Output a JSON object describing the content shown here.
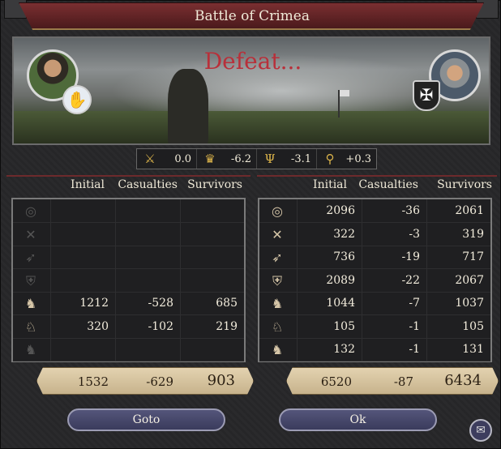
{
  "window": {
    "title": "Battle of Crimea"
  },
  "scene": {
    "outcome": "Defeat..."
  },
  "modifiers": [
    {
      "icon": "crossed-axes-icon",
      "glyph": "⚔",
      "value": "0.0"
    },
    {
      "icon": "crown-icon",
      "glyph": "♛",
      "value": "-6.2"
    },
    {
      "icon": "menorah-icon",
      "glyph": "Ψ",
      "value": "-3.1"
    },
    {
      "icon": "magnifier-icon",
      "glyph": "⚲",
      "value": "+0.3"
    }
  ],
  "headers": {
    "initial": "Initial",
    "casualties": "Casualties",
    "survivors": "Survivors"
  },
  "left_side": {
    "rows": [
      {
        "unit": "light-infantry-icon",
        "glyph": "◎",
        "initial": "",
        "casualties": "",
        "survivors": ""
      },
      {
        "unit": "heavy-infantry-icon",
        "glyph": "✕",
        "initial": "",
        "casualties": "",
        "survivors": ""
      },
      {
        "unit": "archers-icon",
        "glyph": "➶",
        "initial": "",
        "casualties": "",
        "survivors": ""
      },
      {
        "unit": "pikemen-icon",
        "glyph": "⛨",
        "initial": "",
        "casualties": "",
        "survivors": ""
      },
      {
        "unit": "light-cavalry-icon",
        "glyph": "♞",
        "initial": "1212",
        "casualties": "-528",
        "survivors": "685"
      },
      {
        "unit": "knights-icon",
        "glyph": "♘",
        "initial": "320",
        "casualties": "-102",
        "survivors": "219"
      },
      {
        "unit": "horse-archers-icon",
        "glyph": "♞",
        "initial": "",
        "casualties": "",
        "survivors": ""
      }
    ],
    "totals": {
      "initial": "1532",
      "casualties": "-629",
      "survivors": "903"
    }
  },
  "right_side": {
    "rows": [
      {
        "unit": "light-infantry-icon",
        "glyph": "◎",
        "initial": "2096",
        "casualties": "-36",
        "survivors": "2061"
      },
      {
        "unit": "heavy-infantry-icon",
        "glyph": "✕",
        "initial": "322",
        "casualties": "-3",
        "survivors": "319"
      },
      {
        "unit": "archers-icon",
        "glyph": "➶",
        "initial": "736",
        "casualties": "-19",
        "survivors": "717"
      },
      {
        "unit": "pikemen-icon",
        "glyph": "⛨",
        "initial": "2089",
        "casualties": "-22",
        "survivors": "2067"
      },
      {
        "unit": "light-cavalry-icon",
        "glyph": "♞",
        "initial": "1044",
        "casualties": "-7",
        "survivors": "1037"
      },
      {
        "unit": "knights-icon",
        "glyph": "♘",
        "initial": "105",
        "casualties": "-1",
        "survivors": "105"
      },
      {
        "unit": "horse-archers-icon",
        "glyph": "♞",
        "initial": "132",
        "casualties": "-1",
        "survivors": "131"
      }
    ],
    "totals": {
      "initial": "6520",
      "casualties": "-87",
      "survivors": "6434"
    }
  },
  "buttons": {
    "goto": "Goto",
    "ok": "Ok"
  },
  "colors": {
    "title_banner": "#5e2224",
    "defeat_text": "#b8303a",
    "button": "#3a3b5c",
    "totals_parchment": "#d8c6a2"
  }
}
